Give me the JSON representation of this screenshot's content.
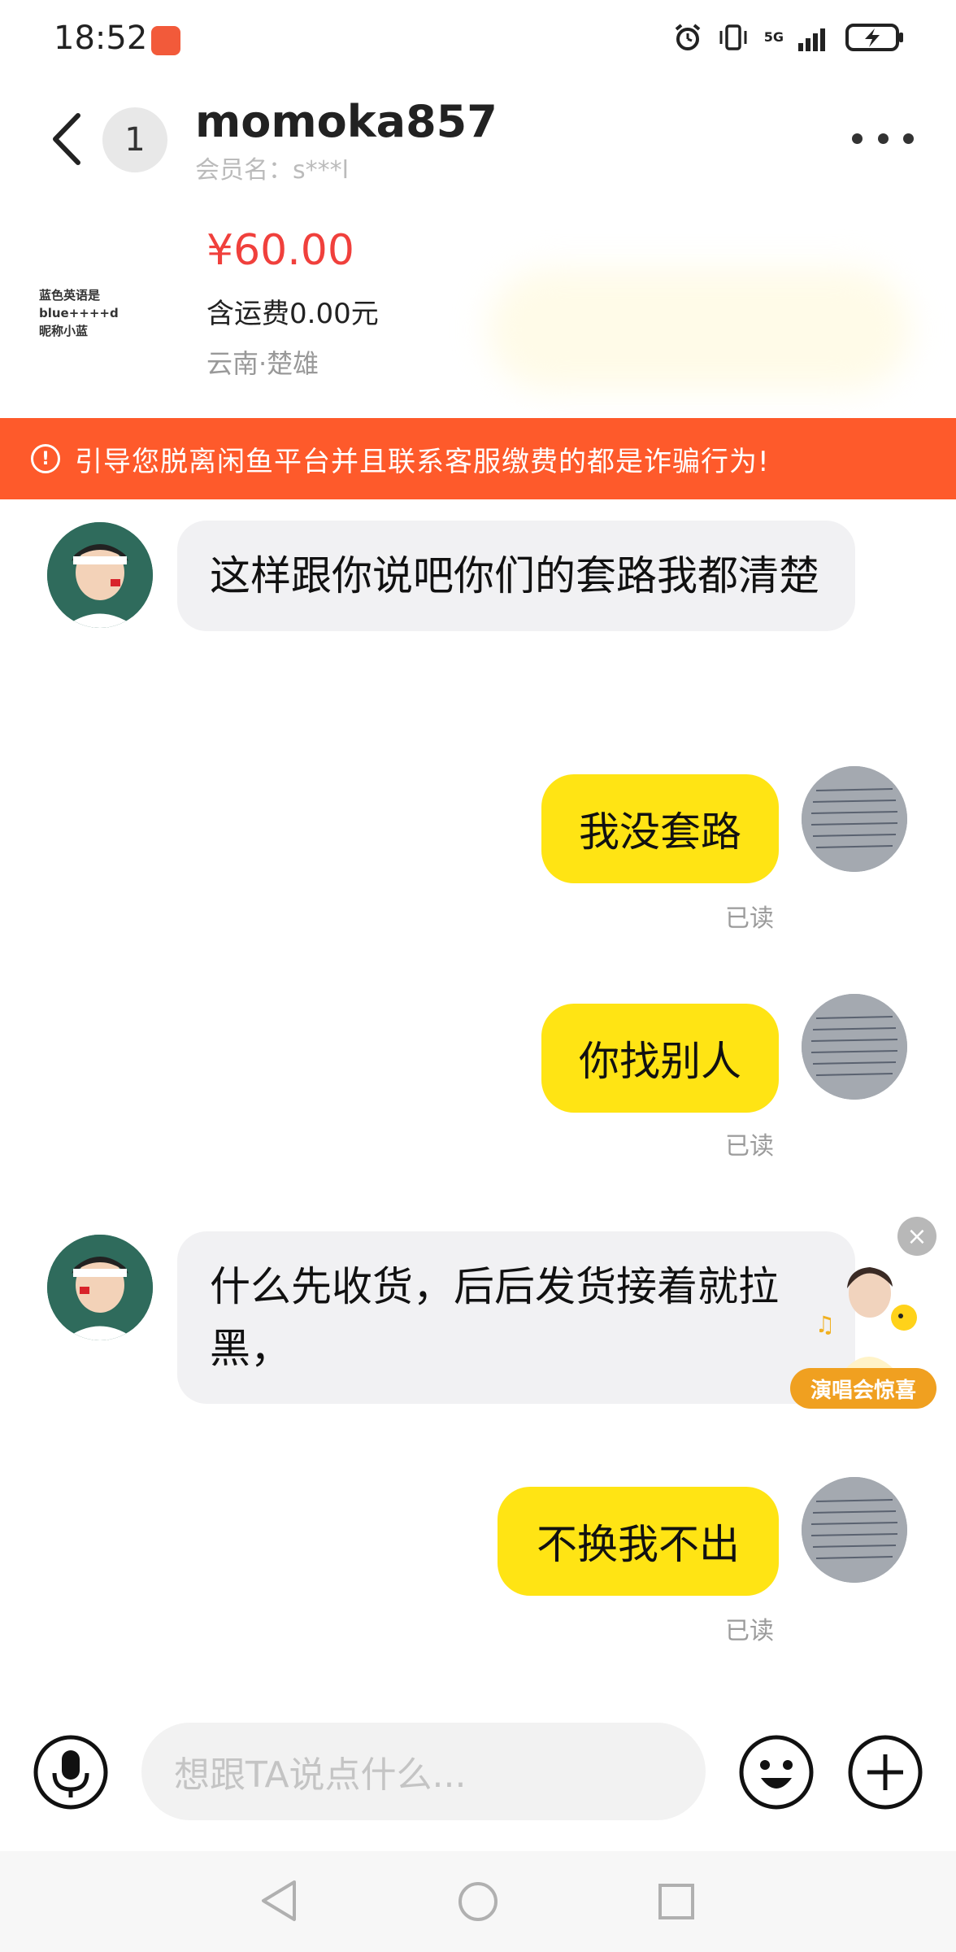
{
  "status_bar": {
    "time": "18:52",
    "network": "5G"
  },
  "header": {
    "unread_count": "1",
    "user_name": "momoka857",
    "member_name": "会员名：s***l"
  },
  "product": {
    "thumb_text": "蓝色英语是blue++++d\n昵称小蓝",
    "price": "¥60.00",
    "shipping": "含运费0.00元",
    "location": "云南·楚雄"
  },
  "warning": {
    "text": "引导您脱离闲鱼平台并且联系客服缴费的都是诈骗行为!"
  },
  "messages": [
    {
      "side": "left",
      "text": "这样跟你说吧你们的套路我都清楚"
    },
    {
      "side": "right",
      "text": "我没套路",
      "status": "已读"
    },
    {
      "side": "right",
      "text": "你找别人",
      "status": "已读"
    },
    {
      "side": "left",
      "text": "什么先收货，后后发货接着就拉黑，"
    },
    {
      "side": "right",
      "text": "不换我不出",
      "status": "已读"
    }
  ],
  "promo": {
    "label": "演唱会惊喜"
  },
  "input": {
    "placeholder": "想跟TA说点什么..."
  },
  "colors": {
    "warning_bg": "#fe5a2b",
    "price": "#f0403c",
    "my_bubble": "#ffe414",
    "their_bubble": "#f1f1f3"
  }
}
